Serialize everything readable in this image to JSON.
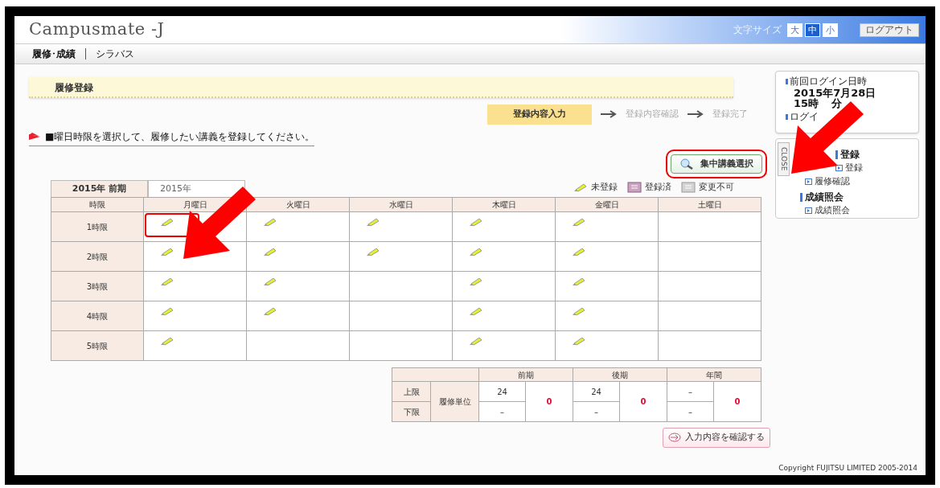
{
  "header": {
    "logo": "Campusmate -J",
    "font_size_label": "文字サイズ",
    "font_sizes": [
      {
        "label": "大",
        "selected": false
      },
      {
        "label": "中",
        "selected": true
      },
      {
        "label": "小",
        "selected": false
      }
    ],
    "logout": "ログアウト"
  },
  "nav": [
    "履修･成績",
    "シラバス"
  ],
  "page_title": "履修登録",
  "steps": [
    {
      "label": "登録内容入力",
      "selected": true
    },
    {
      "label": "登録内容確認",
      "selected": false
    },
    {
      "label": "登録完了",
      "selected": false
    }
  ],
  "instruction": "■曜日時限を選択して、履修したい講義を登録してください。",
  "intensive_button": "集中講義選択",
  "term_tabs": [
    {
      "label": "2015年 前期",
      "selected": true
    },
    {
      "label": "2015年",
      "selected": false
    }
  ],
  "legend": [
    {
      "kind": "pencil",
      "label": "未登録"
    },
    {
      "kind": "registered",
      "label": "登録済"
    },
    {
      "kind": "locked",
      "label": "変更不可"
    }
  ],
  "timetable": {
    "columns": [
      "時限",
      "月曜日",
      "火曜日",
      "水曜日",
      "木曜日",
      "金曜日",
      "土曜日"
    ],
    "rows": [
      {
        "period": "1時限",
        "cells": [
          {
            "open": true
          },
          {
            "open": true
          },
          {
            "open": true
          },
          {
            "open": true
          },
          {
            "open": true
          },
          {
            "open": false
          }
        ]
      },
      {
        "period": "2時限",
        "cells": [
          {
            "open": true
          },
          {
            "open": true
          },
          {
            "open": true
          },
          {
            "open": true
          },
          {
            "open": true
          },
          {
            "open": false
          }
        ]
      },
      {
        "period": "3時限",
        "cells": [
          {
            "open": true
          },
          {
            "open": true
          },
          {
            "open": false
          },
          {
            "open": true
          },
          {
            "open": true
          },
          {
            "open": false
          }
        ]
      },
      {
        "period": "4時限",
        "cells": [
          {
            "open": true
          },
          {
            "open": true
          },
          {
            "open": false
          },
          {
            "open": true
          },
          {
            "open": true
          },
          {
            "open": false
          }
        ]
      },
      {
        "period": "5時限",
        "cells": [
          {
            "open": true
          },
          {
            "open": false
          },
          {
            "open": false
          },
          {
            "open": true
          },
          {
            "open": true
          },
          {
            "open": false
          }
        ]
      }
    ]
  },
  "units": {
    "row_labels": [
      "上限",
      "下限"
    ],
    "group_label": "履修単位",
    "terms": [
      {
        "name": "前期",
        "upper": "24",
        "lower": "–",
        "total": "0"
      },
      {
        "name": "後期",
        "upper": "24",
        "lower": "–",
        "total": "0"
      },
      {
        "name": "年間",
        "upper": "–",
        "lower": "–",
        "total": "0"
      }
    ]
  },
  "confirm_button": "入力内容を確認する",
  "copyright": "Copyright FUJITSU LIMITED 2005-2014",
  "sidebar": {
    "login_label": "前回ログイン日時",
    "login_date": "2015年7月28日",
    "login_time_start": "15時",
    "login_time_end": "分",
    "login_label2": "ログイ",
    "close": "CLOSE",
    "sections": [
      {
        "title": "登録",
        "items": [
          "登録",
          "履修確認"
        ]
      },
      {
        "title": "成績照会",
        "items": [
          "成績照会"
        ]
      }
    ]
  }
}
